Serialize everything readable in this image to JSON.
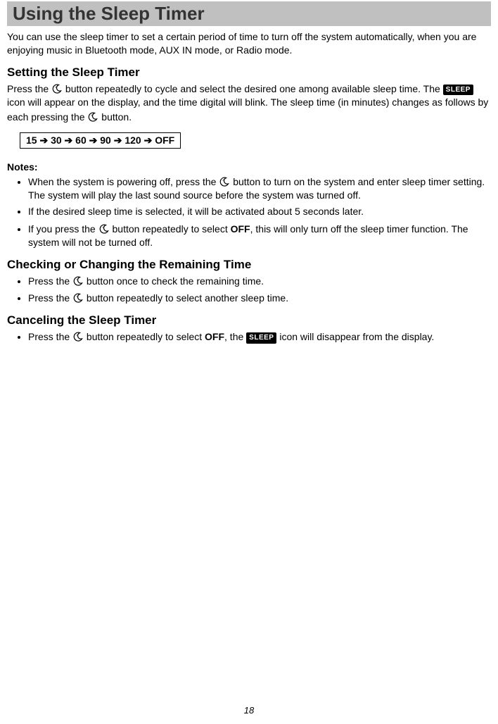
{
  "title": "Using the Sleep Timer",
  "intro": "You can use the sleep timer to set a certain period of time to turn off the system automatically, when you are enjoying music in Bluetooth mode, AUX IN mode, or Radio mode.",
  "setting": {
    "heading": "Setting the Sleep Timer",
    "p1a": "Press the ",
    "p1b": " button repeatedly to cycle and select the desired one among available sleep time. The ",
    "p1c": " icon will appear on the display, and the time digital will blink. The sleep time (in minutes) changes as follows by each pressing the ",
    "p1d": " button.",
    "sleep_badge": "SLEEP",
    "sequence": "15 ➔ 30 ➔ 60 ➔ 90 ➔ 120 ➔ OFF"
  },
  "notes": {
    "label": "Notes:",
    "items": [
      {
        "a": "When the system is powering off, press the ",
        "b": " button to turn on the system and enter sleep timer setting. The system will play the last sound source before the system was turned off."
      },
      {
        "a": "If the desired sleep time is selected, it will be activated about 5 seconds later."
      },
      {
        "a": "If you press the ",
        "b": " button repeatedly to select ",
        "off": "OFF",
        "c": ", this will only turn off the sleep timer function. The system will not be turned off."
      }
    ]
  },
  "checking": {
    "heading": "Checking or Changing the Remaining Time",
    "items": [
      {
        "a": "Press the ",
        "b": " button once to check the remaining time."
      },
      {
        "a": "Press the ",
        "b": " button repeatedly to select another sleep time."
      }
    ]
  },
  "canceling": {
    "heading": "Canceling the Sleep Timer",
    "items": [
      {
        "a": "Press the ",
        "b": " button repeatedly to select ",
        "off": "OFF",
        "c": ", the ",
        "d": " icon will disappear from the display."
      }
    ]
  },
  "page_number": "18"
}
